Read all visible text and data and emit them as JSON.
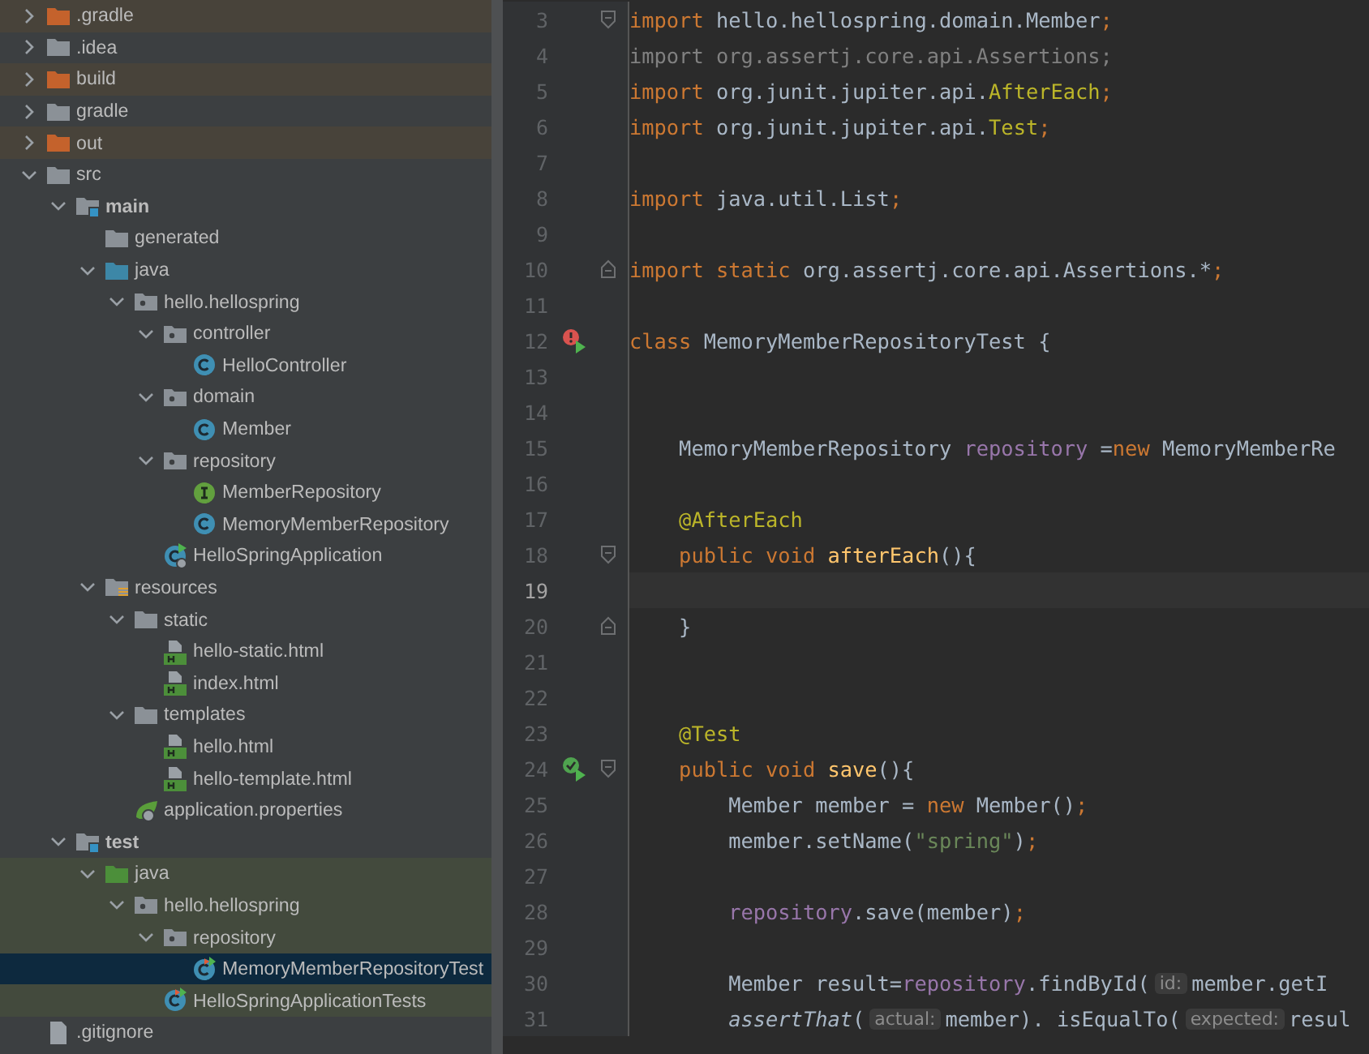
{
  "project_tree": [
    {
      "label": ".gradle",
      "kind": "excluded-folder",
      "expanded": false,
      "selected": false
    },
    {
      "label": ".idea",
      "kind": "folder",
      "expanded": false,
      "selected": false
    },
    {
      "label": "build",
      "kind": "excluded-folder",
      "expanded": false,
      "selected": false
    },
    {
      "label": "gradle",
      "kind": "folder",
      "expanded": false,
      "selected": false
    },
    {
      "label": "out",
      "kind": "excluded-folder",
      "expanded": false,
      "selected": false
    },
    {
      "label": "src",
      "kind": "folder",
      "expanded": true,
      "selected": false,
      "children": [
        {
          "label": "main",
          "kind": "module-folder",
          "expanded": true,
          "selected": false,
          "children": [
            {
              "label": "generated",
              "kind": "folder",
              "selected": false
            },
            {
              "label": "java",
              "kind": "source-folder",
              "expanded": true,
              "selected": false,
              "children": [
                {
                  "label": "hello.hellospring",
                  "kind": "package",
                  "expanded": true,
                  "selected": false,
                  "children": [
                    {
                      "label": "controller",
                      "kind": "package",
                      "expanded": true,
                      "selected": false,
                      "children": [
                        {
                          "label": "HelloController",
                          "kind": "class",
                          "selected": false
                        }
                      ]
                    },
                    {
                      "label": "domain",
                      "kind": "package",
                      "expanded": true,
                      "selected": false,
                      "children": [
                        {
                          "label": "Member",
                          "kind": "class",
                          "selected": false
                        }
                      ]
                    },
                    {
                      "label": "repository",
                      "kind": "package",
                      "expanded": true,
                      "selected": false,
                      "children": [
                        {
                          "label": "MemberRepository",
                          "kind": "interface",
                          "selected": false
                        },
                        {
                          "label": "MemoryMemberRepository",
                          "kind": "class",
                          "selected": false
                        }
                      ]
                    },
                    {
                      "label": "HelloSpringApplication",
                      "kind": "app-class",
                      "selected": false
                    }
                  ]
                }
              ]
            },
            {
              "label": "resources",
              "kind": "resources-folder",
              "expanded": true,
              "selected": false,
              "children": [
                {
                  "label": "static",
                  "kind": "folder",
                  "expanded": true,
                  "selected": false,
                  "children": [
                    {
                      "label": "hello-static.html",
                      "kind": "html",
                      "selected": false
                    },
                    {
                      "label": "index.html",
                      "kind": "html",
                      "selected": false
                    }
                  ]
                },
                {
                  "label": "templates",
                  "kind": "folder",
                  "expanded": true,
                  "selected": false,
                  "children": [
                    {
                      "label": "hello.html",
                      "kind": "html",
                      "selected": false
                    },
                    {
                      "label": "hello-template.html",
                      "kind": "html",
                      "selected": false
                    }
                  ]
                },
                {
                  "label": "application.properties",
                  "kind": "spring-config",
                  "selected": false
                }
              ]
            }
          ]
        },
        {
          "label": "test",
          "kind": "module-folder",
          "expanded": true,
          "selected": false,
          "children": [
            {
              "label": "java",
              "kind": "test-folder",
              "expanded": true,
              "selected": false,
              "children": [
                {
                  "label": "hello.hellospring",
                  "kind": "package",
                  "expanded": true,
                  "selected": false,
                  "children": [
                    {
                      "label": "repository",
                      "kind": "package",
                      "expanded": true,
                      "selected": false,
                      "children": [
                        {
                          "label": "MemoryMemberRepositoryTest",
                          "kind": "test-class",
                          "selected": true
                        }
                      ]
                    },
                    {
                      "label": "HelloSpringApplicationTests",
                      "kind": "test-class",
                      "selected": false
                    }
                  ]
                }
              ]
            }
          ]
        }
      ]
    },
    {
      "label": ".gitignore",
      "kind": "file",
      "selected": false
    }
  ],
  "editor": {
    "lines": [
      {
        "number": "3",
        "current": false,
        "fold_marker": {
          "kind": "start"
        },
        "tokens": [
          {
            "t": "import ",
            "kind": "kw"
          },
          {
            "t": "hello.hellospring.domain.Member",
            "kind": "plain"
          },
          {
            "t": ";",
            "kind": "kw"
          }
        ]
      },
      {
        "number": "4",
        "current": false,
        "tokens": [
          {
            "t": "import org.assertj.core.api.Assertions;",
            "kind": "unused"
          }
        ]
      },
      {
        "number": "5",
        "current": false,
        "tokens": [
          {
            "t": "import ",
            "kind": "kw"
          },
          {
            "t": "org.junit.jupiter.api.",
            "kind": "plain"
          },
          {
            "t": "AfterEach",
            "kind": "annotation"
          },
          {
            "t": ";",
            "kind": "kw"
          }
        ]
      },
      {
        "number": "6",
        "current": false,
        "tokens": [
          {
            "t": "import ",
            "kind": "kw"
          },
          {
            "t": "org.junit.jupiter.api.",
            "kind": "plain"
          },
          {
            "t": "Test",
            "kind": "annotation"
          },
          {
            "t": ";",
            "kind": "kw"
          }
        ]
      },
      {
        "number": "7",
        "current": false
      },
      {
        "number": "8",
        "current": false,
        "tokens": [
          {
            "t": "import ",
            "kind": "kw"
          },
          {
            "t": "java.util.List",
            "kind": "plain"
          },
          {
            "t": ";",
            "kind": "kw"
          }
        ]
      },
      {
        "number": "9",
        "current": false
      },
      {
        "number": "10",
        "current": false,
        "fold_marker": {
          "kind": "end"
        },
        "tokens": [
          {
            "t": "import static ",
            "kind": "kw"
          },
          {
            "t": "org.assertj.core.api.Assertions.*",
            "kind": "plain"
          },
          {
            "t": ";",
            "kind": "kw"
          }
        ]
      },
      {
        "number": "11",
        "current": false
      },
      {
        "number": "12",
        "current": false,
        "gutter_icon": {
          "kind": "run-error"
        },
        "tokens": [
          {
            "t": "class ",
            "kind": "kw"
          },
          {
            "t": "MemoryMemberRepositoryTest {",
            "kind": "plain"
          }
        ]
      },
      {
        "number": "13",
        "current": false
      },
      {
        "number": "14",
        "current": false
      },
      {
        "number": "15",
        "current": false,
        "tokens": [
          {
            "t": "    MemoryMemberRepository ",
            "kind": "plain"
          },
          {
            "t": "repository",
            "kind": "field"
          },
          {
            "t": " =",
            "kind": "plain"
          },
          {
            "t": "new ",
            "kind": "kw"
          },
          {
            "t": "MemoryMemberRe",
            "kind": "plain"
          }
        ]
      },
      {
        "number": "16",
        "current": false
      },
      {
        "number": "17",
        "current": false,
        "tokens": [
          {
            "t": "    @AfterEach",
            "kind": "annotation"
          }
        ]
      },
      {
        "number": "18",
        "current": false,
        "fold_marker": {
          "kind": "start"
        },
        "tokens": [
          {
            "t": "    public void ",
            "kind": "kw"
          },
          {
            "t": "afterEach",
            "kind": "method"
          },
          {
            "t": "(){",
            "kind": "plain"
          }
        ]
      },
      {
        "number": "19",
        "current": true
      },
      {
        "number": "20",
        "current": false,
        "fold_marker": {
          "kind": "end"
        },
        "tokens": [
          {
            "t": "    }",
            "kind": "plain"
          }
        ]
      },
      {
        "number": "21",
        "current": false
      },
      {
        "number": "22",
        "current": false
      },
      {
        "number": "23",
        "current": false,
        "tokens": [
          {
            "t": "    @Test",
            "kind": "annotation"
          }
        ]
      },
      {
        "number": "24",
        "current": false,
        "fold_marker": {
          "kind": "start"
        },
        "gutter_icon": {
          "kind": "run-passed"
        },
        "tokens": [
          {
            "t": "    public void ",
            "kind": "kw"
          },
          {
            "t": "save",
            "kind": "method"
          },
          {
            "t": "(){",
            "kind": "plain"
          }
        ]
      },
      {
        "number": "25",
        "current": false,
        "tokens": [
          {
            "t": "        Member member = ",
            "kind": "plain"
          },
          {
            "t": "new ",
            "kind": "kw"
          },
          {
            "t": "Member()",
            "kind": "plain"
          },
          {
            "t": ";",
            "kind": "kw"
          }
        ]
      },
      {
        "number": "26",
        "current": false,
        "tokens": [
          {
            "t": "        member.setName(",
            "kind": "plain"
          },
          {
            "t": "\"spring\"",
            "kind": "string"
          },
          {
            "t": ")",
            "kind": "plain"
          },
          {
            "t": ";",
            "kind": "kw"
          }
        ]
      },
      {
        "number": "27",
        "current": false
      },
      {
        "number": "28",
        "current": false,
        "tokens": [
          {
            "t": "        repository",
            "kind": "field"
          },
          {
            "t": ".save(member)",
            "kind": "plain"
          },
          {
            "t": ";",
            "kind": "kw"
          }
        ]
      },
      {
        "number": "29",
        "current": false
      },
      {
        "number": "30",
        "current": false,
        "tokens": [
          {
            "t": "        Member result=",
            "kind": "plain"
          },
          {
            "t": "repository",
            "kind": "field"
          },
          {
            "t": ".findById(",
            "kind": "plain"
          },
          {
            "t": "id:",
            "kind": "hint"
          },
          {
            "t": "member.getI",
            "kind": "plain"
          }
        ]
      },
      {
        "number": "31",
        "current": false,
        "tokens": [
          {
            "t": "        assertThat",
            "kind": "static-call"
          },
          {
            "t": "(",
            "kind": "plain"
          },
          {
            "t": "actual:",
            "kind": "hint"
          },
          {
            "t": "member). isEqualTo(",
            "kind": "plain"
          },
          {
            "t": "expected:",
            "kind": "hint"
          },
          {
            "t": "resul",
            "kind": "plain"
          }
        ]
      }
    ]
  }
}
